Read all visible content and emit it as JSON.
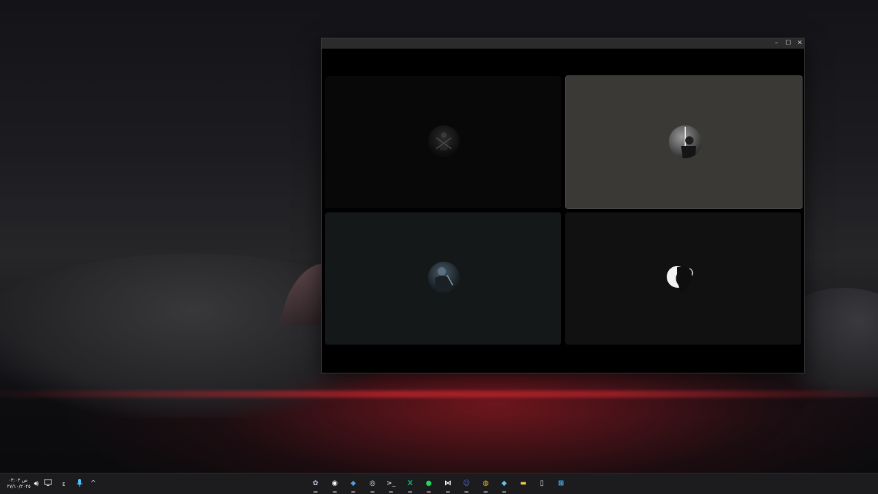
{
  "window": {
    "controls": {
      "minimize": "–",
      "maximize": "☐",
      "close": "✕"
    },
    "tiles": [
      {
        "id": "tile-1",
        "bg": "#080808",
        "highlighted": false
      },
      {
        "id": "tile-2",
        "bg": "#3a3936",
        "highlighted": true
      },
      {
        "id": "tile-3",
        "bg": "#141819",
        "highlighted": false
      },
      {
        "id": "tile-4",
        "bg": "#111111",
        "highlighted": false
      }
    ]
  },
  "taskbar": {
    "clock": {
      "time": "ص ٠٣:٠٣",
      "date": "٢٧/١٠/٢٠٢٥"
    },
    "language": "E",
    "tray_icons": [
      "speaker-icon",
      "network-icon",
      "microphone-icon",
      "chevron-up-icon"
    ],
    "apps": [
      {
        "name": "anime-app-icon",
        "glyph": "✿",
        "color": "#c9b8e8"
      },
      {
        "name": "obs-icon",
        "glyph": "◉",
        "color": "#ffffff"
      },
      {
        "name": "steam-icon",
        "glyph": "◆",
        "color": "#5b9bd5"
      },
      {
        "name": "github-desktop-icon",
        "glyph": "◎",
        "color": "#e8e8e8"
      },
      {
        "name": "terminal-icon",
        "glyph": ">_",
        "color": "#d0d0d0"
      },
      {
        "name": "excel-icon",
        "glyph": "X",
        "color": "#21a366"
      },
      {
        "name": "spotify-icon",
        "glyph": "●",
        "color": "#1ed760"
      },
      {
        "name": "capcut-icon",
        "glyph": "⋈",
        "color": "#ffffff"
      },
      {
        "name": "discord-icon",
        "glyph": "☺",
        "color": "#5865f2"
      },
      {
        "name": "chrome-icon",
        "glyph": "◍",
        "color": "#fbbc04"
      },
      {
        "name": "steam-2-icon",
        "glyph": "◆",
        "color": "#66c0f4"
      },
      {
        "name": "file-explorer-icon",
        "glyph": "▬",
        "color": "#f2c94c"
      },
      {
        "name": "notepad-icon",
        "glyph": "▯",
        "color": "#f0f0f0"
      },
      {
        "name": "windows-start-icon",
        "glyph": "⊞",
        "color": "#4cc2ff"
      }
    ]
  }
}
